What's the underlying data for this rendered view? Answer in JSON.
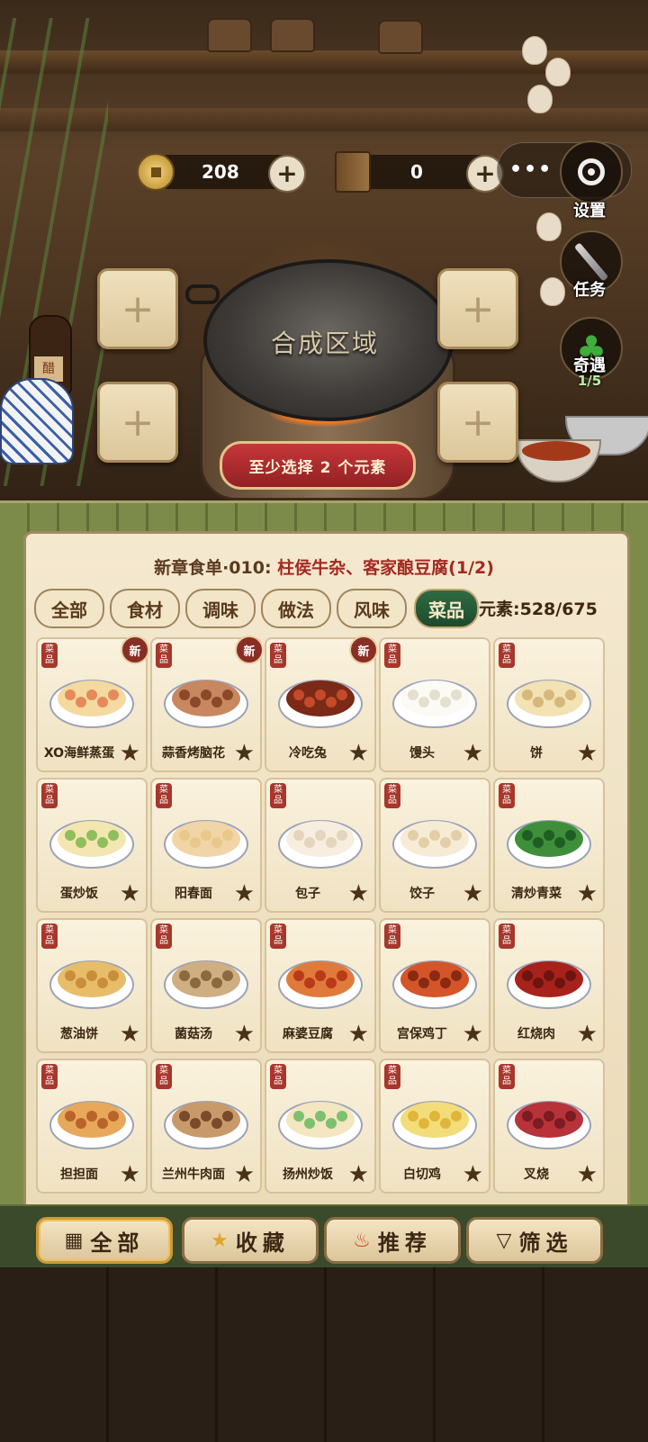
{
  "header": {
    "coins": "208",
    "books": "0",
    "more": "•••"
  },
  "side_buttons": {
    "settings": "设置",
    "tasks": "任务",
    "fortune": "奇遇",
    "fortune_count": "1/5"
  },
  "synthesis": {
    "area_label": "合成区域",
    "hint": "至少选择 2 个元素"
  },
  "order": {
    "prefix": "新章食单·010:",
    "dishes": "柱侯牛杂、客家酿豆腐(1/2)"
  },
  "tabs": [
    "全部",
    "食材",
    "调味",
    "做法",
    "风味",
    "菜品"
  ],
  "element_count": "元素:528/675",
  "badge_label": "菜品",
  "new_label": "新",
  "cards": [
    {
      "name": "XO海鲜蒸蛋",
      "is_new": true
    },
    {
      "name": "蒜香烤脑花",
      "is_new": true
    },
    {
      "name": "冷吃兔",
      "is_new": true
    },
    {
      "name": "馒头",
      "is_new": false
    },
    {
      "name": "饼",
      "is_new": false
    },
    {
      "name": "蛋炒饭",
      "is_new": false
    },
    {
      "name": "阳春面",
      "is_new": false
    },
    {
      "name": "包子",
      "is_new": false
    },
    {
      "name": "饺子",
      "is_new": false
    },
    {
      "name": "清炒青菜",
      "is_new": false
    },
    {
      "name": "葱油饼",
      "is_new": false
    },
    {
      "name": "菌菇汤",
      "is_new": false
    },
    {
      "name": "麻婆豆腐",
      "is_new": false
    },
    {
      "name": "宫保鸡丁",
      "is_new": false
    },
    {
      "name": "红烧肉",
      "is_new": false
    },
    {
      "name": "担担面",
      "is_new": false
    },
    {
      "name": "兰州牛肉面",
      "is_new": false
    },
    {
      "name": "扬州炒饭",
      "is_new": false
    },
    {
      "name": "白切鸡",
      "is_new": false
    },
    {
      "name": "叉烧",
      "is_new": false
    }
  ],
  "bottom_bar": {
    "all": "全部",
    "favorites": "收藏",
    "recommend": "推荐",
    "filter": "筛选"
  },
  "colors": {
    "active_tab": "#2f6b43",
    "hint_button": "#c6373a",
    "badge": "#a7372c"
  }
}
